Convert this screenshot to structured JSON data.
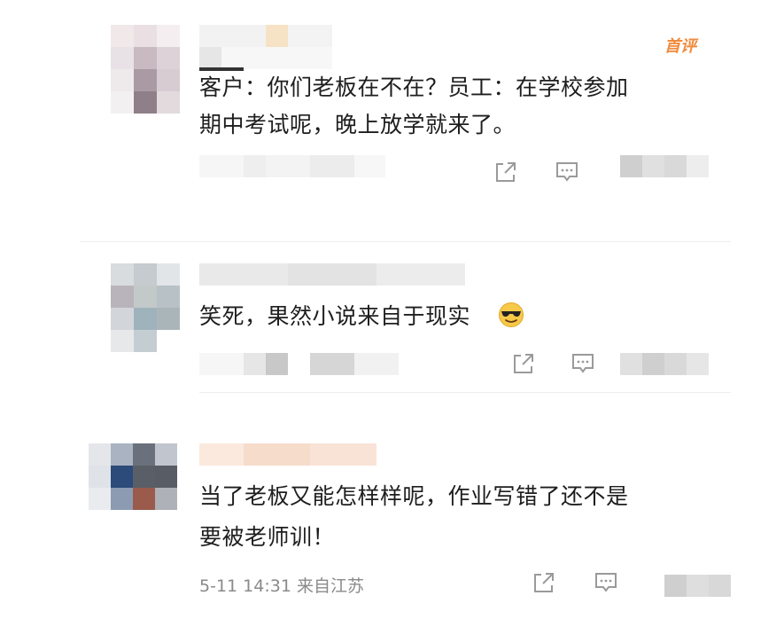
{
  "comments": [
    {
      "is_first": true,
      "badge_label": "首评",
      "text_lines": [
        "客户：你们老板在不在？员工：在学校参加",
        "期中考试呢，晚上放学就来了。"
      ],
      "meta": ""
    },
    {
      "is_first": false,
      "badge_label": "",
      "text_lines": [
        "笑死，果然小说来自于现实"
      ],
      "emoji": "sunglasses-emoji",
      "meta": ""
    },
    {
      "is_first": false,
      "badge_label": "",
      "text_lines": [
        "当了老板又能怎样样呢，作业写错了还不是",
        "要被老师训！"
      ],
      "meta": "5-11 14:31 来自江苏"
    }
  ],
  "icons": [
    "share-icon",
    "reply-icon"
  ],
  "colors": {
    "badge": "#f08a3c",
    "meta": "#8a8a8a",
    "text": "#1e1e1e",
    "divider": "#eeeeee"
  }
}
